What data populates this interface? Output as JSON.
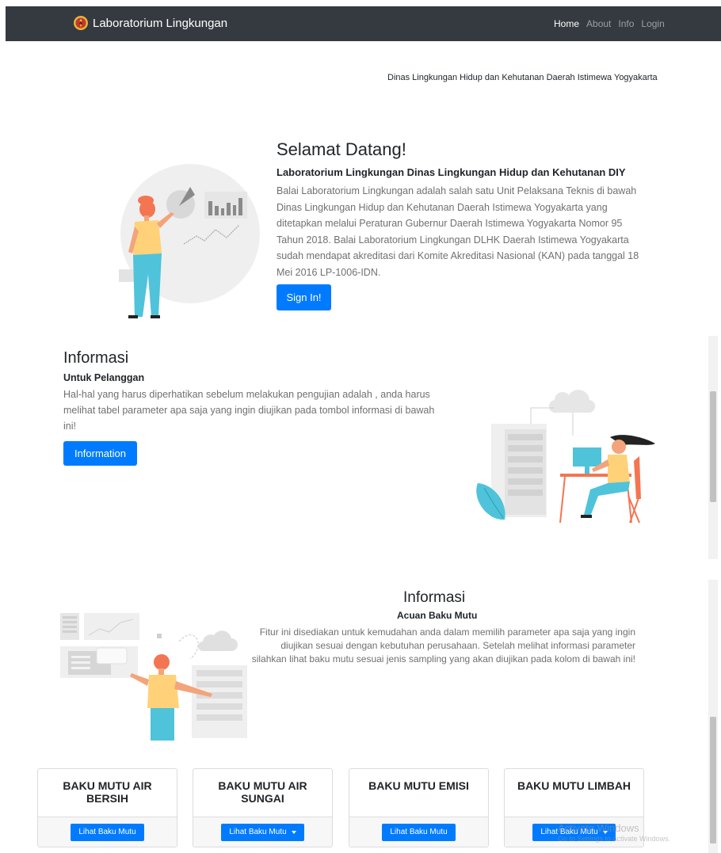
{
  "navbar": {
    "brand": "Laboratorium Lingkungan",
    "links": [
      {
        "label": "Home",
        "active": true
      },
      {
        "label": "About",
        "active": false
      },
      {
        "label": "Info",
        "active": false
      },
      {
        "label": "Login",
        "active": false
      }
    ]
  },
  "agency": "Dinas Lingkungan Hidup dan Kehutanan Daerah Istimewa Yogyakarta",
  "hero": {
    "title": "Selamat Datang!",
    "subtitle": "Laboratorium Lingkungan Dinas Lingkungan Hidup dan Kehutanan DIY",
    "description": "Balai Laboratorium Lingkungan adalah salah satu Unit Pelaksana Teknis di bawah Dinas Lingkungan Hidup dan Kehutanan Daerah Istimewa Yogyakarta yang ditetapkan melalui Peraturan Gubernur Daerah Istimewa Yogyakarta Nomor 95 Tahun 2018. Balai Laboratorium Lingkungan DLHK Daerah Istimewa Yogyakarta sudah mendapat akreditasi dari Komite Akreditasi Nasional (KAN) pada tanggal 18 Mei 2016 LP-1006-IDN.",
    "button": "Sign In!"
  },
  "info_pelanggan": {
    "title": "Informasi",
    "subtitle": "Untuk Pelanggan",
    "description": "Hal-hal yang harus diperhatikan sebelum melakukan pengujian adalah , anda harus melihat tabel parameter apa saja yang ingin diujikan pada tombol informasi di bawah ini!",
    "button": "Information"
  },
  "info_baku_mutu": {
    "title": "Informasi",
    "subtitle": "Acuan Baku Mutu",
    "description": "Fitur ini disediakan untuk kemudahan anda dalam memilih parameter apa saja yang ingin diujikan sesuai dengan kebutuhan perusahaan. Setelah melihat informasi parameter silahkan lihat baku mutu sesuai jenis sampling yang akan diujikan pada kolom di bawah ini!"
  },
  "cards": [
    {
      "title": "BAKU MUTU AIR BERSIH",
      "button": "Lihat Baku Mutu",
      "dropdown": false
    },
    {
      "title": "BAKU MUTU AIR SUNGAI",
      "button": "Lihat Baku Mutu",
      "dropdown": true
    },
    {
      "title": "BAKU MUTU EMISI",
      "button": "Lihat Baku Mutu",
      "dropdown": false
    },
    {
      "title": "BAKU MUTU LIMBAH",
      "button": "Lihat Baku Mutu",
      "dropdown": true
    }
  ],
  "watermark": {
    "line1": "Activate Windows",
    "line2": "Go to Settings to activate Windows."
  },
  "colors": {
    "navbar": "#343a40",
    "primary": "#007bff",
    "accent_orange": "#f37552",
    "accent_teal": "#4fc3d9",
    "accent_yellow": "#ffd27a"
  }
}
